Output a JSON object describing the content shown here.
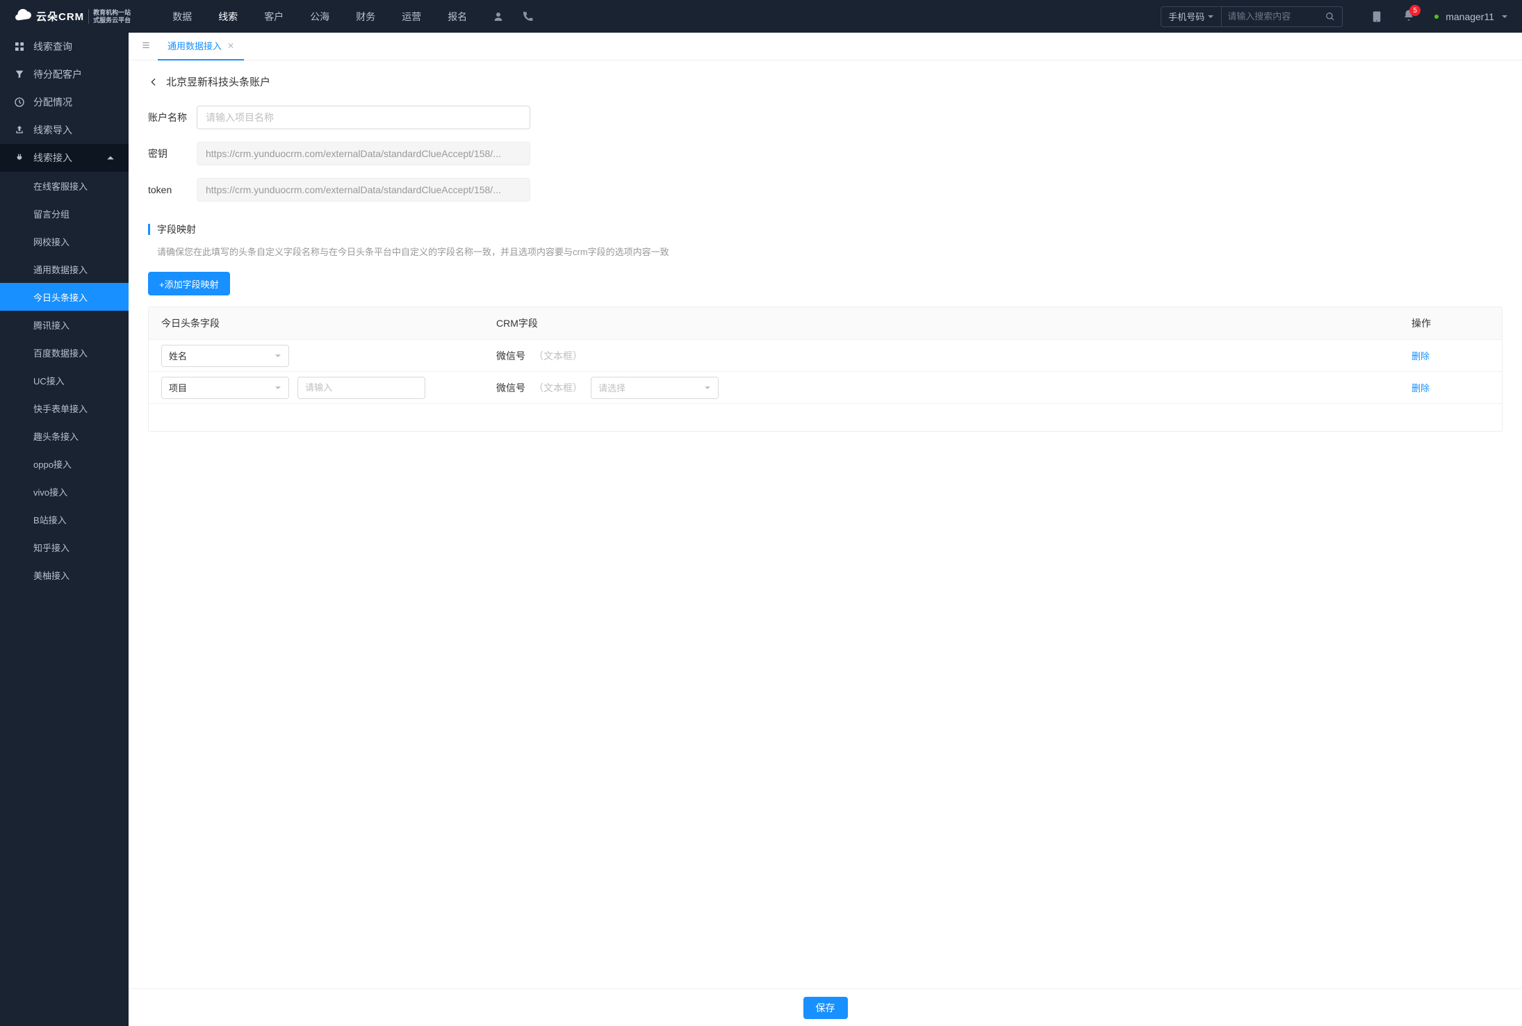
{
  "header": {
    "logo_text": "云朵CRM",
    "logo_sub1": "教育机构一站",
    "logo_sub2": "式服务云平台",
    "nav": [
      "数据",
      "线索",
      "客户",
      "公海",
      "财务",
      "运营",
      "报名"
    ],
    "nav_active_index": 1,
    "search_select": "手机号码",
    "search_placeholder": "请输入搜索内容",
    "badge_count": "5",
    "username": "manager11"
  },
  "sidebar": {
    "top_items": [
      {
        "label": "线索查询",
        "icon": "grid"
      },
      {
        "label": "待分配客户",
        "icon": "filter"
      },
      {
        "label": "分配情况",
        "icon": "clock"
      },
      {
        "label": "线索导入",
        "icon": "share"
      }
    ],
    "group_label": "线索接入",
    "group_icon": "plug",
    "sub_items": [
      "在线客服接入",
      "留言分组",
      "网校接入",
      "通用数据接入",
      "今日头条接入",
      "腾讯接入",
      "百度数据接入",
      "UC接入",
      "快手表单接入",
      "趣头条接入",
      "oppo接入",
      "vivo接入",
      "B站接入",
      "知乎接入",
      "美柚接入"
    ],
    "active_sub_index": 4
  },
  "tabs": {
    "items": [
      {
        "label": "通用数据接入"
      }
    ],
    "active_index": 0
  },
  "page": {
    "title": "北京昱新科技头条账户",
    "form": {
      "name_label": "账户名称",
      "name_placeholder": "请输入项目名称",
      "secret_label": "密钥",
      "secret_value": "https://crm.yunduocrm.com/externalData/standardClueAccept/158/...",
      "token_label": "token",
      "token_value": "https://crm.yunduocrm.com/externalData/standardClueAccept/158/..."
    },
    "section": {
      "title": "字段映射",
      "desc": "请确保您在此填写的头条自定义字段名称与在今日头条平台中自定义的字段名称一致，并且选项内容要与crm字段的选项内容一致"
    },
    "add_btn": "+添加字段映射",
    "table": {
      "headers": [
        "今日头条字段",
        "CRM字段",
        "操作"
      ],
      "rows": [
        {
          "tt_field": "姓名",
          "crm_label": "微信号",
          "crm_type": "（文本框）",
          "has_extra_input": false,
          "has_crm_select": false
        },
        {
          "tt_field": "项目",
          "crm_label": "微信号",
          "crm_type": "（文本框）",
          "has_extra_input": true,
          "extra_placeholder": "请输入",
          "has_crm_select": true,
          "crm_select_placeholder": "请选择"
        }
      ],
      "delete_label": "删除"
    },
    "save": "保存"
  }
}
